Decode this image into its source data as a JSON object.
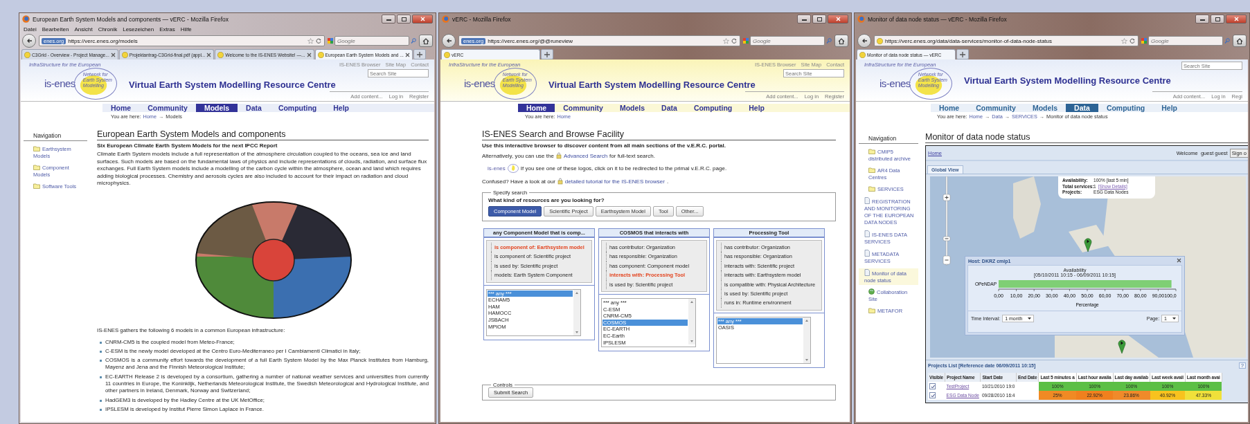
{
  "windows": [
    {
      "title": "European Earth System Models and components — vERC - Mozilla Firefox",
      "menu": [
        "Datei",
        "Bearbeiten",
        "Ansicht",
        "Chronik",
        "Lesezeichen",
        "Extras",
        "Hilfe"
      ],
      "address": {
        "badge": "enes.org",
        "url": "https://verc.enes.org/models"
      },
      "search_placeholder": "Google",
      "tabs": [
        {
          "label": "C3Grid - Overview - Project Manage...",
          "selected": false,
          "closable": true
        },
        {
          "label": "Projektantrag-C3Grid-final.pdf (appl...",
          "selected": false,
          "closable": true
        },
        {
          "label": "Welcome to the IS-ENES Website! —...",
          "selected": false,
          "closable": true
        },
        {
          "label": "European Earth System Models and ...",
          "selected": true,
          "closable": true
        }
      ],
      "site": {
        "logo": {
          "tagline": "InfraStructure for the European",
          "name": "is-enes",
          "network": "Network for Earth System Modelling"
        },
        "header_links": [
          "IS-ENES Browser",
          "Site Map",
          "Contact"
        ],
        "search_placeholder": "Search Site",
        "title": "Virtual Earth System Modelling Resource Centre",
        "user_links": [
          "Add content...",
          "Log in",
          "Register"
        ],
        "nav": [
          {
            "label": "Home",
            "selected": false
          },
          {
            "label": "Community",
            "selected": false
          },
          {
            "label": "Models",
            "selected": true
          },
          {
            "label": "Data",
            "selected": false
          },
          {
            "label": "Computing",
            "selected": false
          },
          {
            "label": "Help",
            "selected": false
          }
        ],
        "breadcrumb": {
          "label": "You are here:",
          "crumbs": [
            {
              "text": "Home",
              "link": true
            },
            {
              "before": "→",
              "text": "Models",
              "link": false
            }
          ]
        }
      },
      "page": {
        "kind": "article",
        "sidebar": {
          "heading": "Navigation",
          "items": [
            {
              "kind": "folder",
              "label": "Earthsystem Models",
              "selected": false
            },
            {
              "kind": "folder",
              "label": "Component Models",
              "selected": false
            },
            {
              "kind": "folder",
              "label": "Software Tools",
              "selected": false
            }
          ]
        },
        "heading": "European Earth System Models and components",
        "subtitle": "Six European Climate Earth System Models for the next IPCC Report",
        "paragraph": "Climate Earth System models include a full representation of the atmosphere circulation coupled to the oceans, sea ice and land surfaces. Such models are based on the fundamental laws of physics and include representations of clouds, radiation, and surface flux exchanges. Full Earth System models include a modelling of the carbon cycle within the atmosphere, ocean and land which requires adding biological processes. Chemistry and aerosols cycles are also included to account for their impact on radiation and cloud microphysics.",
        "intro": "IS-ENES gathers the following 6 models in a common European infrastructure:",
        "bullets": [
          "CNRM-CM5 is the coupled model from Meteo-France;",
          "C-ESM is the newly model developed at the Centro Euro-Mediterraneo per I Cambiamenti Climatici in Italy;",
          "COSMOS is a community effort towards the development of a full Earth System Model by the Max Planck Institutes from Hamburg, Mayenz and Jena and the Finnish Meteorological Institute;",
          "EC-EARTH Release 2 is developed by a consortium, gathering a number of national weather services and universities from currently 11 countries in Europe, the Koninklijk, Netherlands Meteorological Institute, the Swedish Meteorological and Hydrological Institute, and other partners in Ireland, Denmark, Norway and Switzerland;",
          "HadGEM3 is developed by the Hadley Centre at the UK MetOffice;",
          "IPSLESM is developed by Institut Pierre Simon Laplace in France."
        ]
      }
    },
    {
      "title": "vERC - Mozilla Firefox",
      "address": {
        "badge": "enes.org",
        "url": "https://verc.enes.org/@@runeview"
      },
      "search_placeholder": "Google",
      "tabs": [
        {
          "label": "vERC",
          "selected": true,
          "closable": false
        }
      ],
      "site": {
        "logo": {
          "tagline": "InfraStructure for the European",
          "name": "is-enes",
          "network": "Network for Earth System Modelling"
        },
        "header_links": [
          "IS-ENES Browser",
          "Site Map",
          "Contact"
        ],
        "search_placeholder": "Search Site",
        "title": "Virtual Earth System Modelling Resource Centre",
        "user_links": [
          "Add content...",
          "Log in",
          "Register"
        ],
        "nav": [
          {
            "label": "Home",
            "selected": true
          },
          {
            "label": "Community",
            "selected": false
          },
          {
            "label": "Models",
            "selected": false
          },
          {
            "label": "Data",
            "selected": false
          },
          {
            "label": "Computing",
            "selected": false
          },
          {
            "label": "Help",
            "selected": false
          }
        ],
        "breadcrumb": {
          "label": "You are here:",
          "crumbs": [
            {
              "text": "Home",
              "link": true
            }
          ]
        }
      },
      "page": {
        "kind": "browser",
        "heading": "IS-ENES Search and Browse Facility",
        "lead": "Use this interactive browser to discover content from all main sections of the v.E.R.C. portal.",
        "advanced": {
          "before": "Alternatively, you can use the",
          "link": "Advanced Search",
          "after": "for full-text search."
        },
        "logo_note": {
          "logo": "is-enes",
          "text": "If you see one of these logos, click on it to be redirected to the primal v.E.R.C. page."
        },
        "tutorial": {
          "before": "Confused? Have a look at our",
          "link": "detailed tutorial for the IS-ENES browser",
          "after": "."
        },
        "specify": {
          "legend": "Specify search",
          "question": "What kind of resources are you looking for?",
          "buttons": [
            {
              "label": "Component Model",
              "selected": true
            },
            {
              "label": "Scientific Project",
              "selected": false
            },
            {
              "label": "Earthsystem Model",
              "selected": false
            },
            {
              "label": "Tool",
              "selected": false
            },
            {
              "label": "Other...",
              "selected": false
            }
          ]
        },
        "columns": [
          {
            "header": "any Component Model that is comp...",
            "relations": [
              {
                "text": "is component of: Earthsystem model",
                "selected": true
              },
              {
                "text": "is component of: Scientific project",
                "selected": false
              },
              {
                "text": "is used by: Scientific project",
                "selected": false
              },
              {
                "text": "models: Earth System Component",
                "selected": false
              }
            ],
            "options": [
              {
                "text": "*** any ***",
                "selected": true
              },
              {
                "text": "ECHAM5",
                "selected": false
              },
              {
                "text": "HAM",
                "selected": false
              },
              {
                "text": "HAMOCC",
                "selected": false
              },
              {
                "text": "JSBACH",
                "selected": false
              },
              {
                "text": "MPIOM",
                "selected": false
              }
            ]
          },
          {
            "header": "COSMOS that interacts with",
            "relations": [
              {
                "text": "has contributor: Organization",
                "selected": false
              },
              {
                "text": "has responsible: Organization",
                "selected": false
              },
              {
                "text": "has component: Component model",
                "selected": false
              },
              {
                "text": "interacts with: Processing Tool",
                "selected": true
              },
              {
                "text": "is used by: Scientific project",
                "selected": false
              }
            ],
            "options": [
              {
                "text": "*** any ***",
                "selected": false
              },
              {
                "text": "C-ESM",
                "selected": false
              },
              {
                "text": "CNRM-CM5",
                "selected": false
              },
              {
                "text": "COSMOS",
                "selected": true
              },
              {
                "text": "EC-EARTH",
                "selected": false
              },
              {
                "text": "EC-Earth",
                "selected": false
              },
              {
                "text": "IPSLESM",
                "selected": false
              }
            ]
          },
          {
            "header": "Processing Tool",
            "relations": [
              {
                "text": "has contributor: Organization",
                "selected": false
              },
              {
                "text": "has responsible: Organization",
                "selected": false
              },
              {
                "text": "interacts with: Scientific project",
                "selected": false
              },
              {
                "text": "interacts with: Earthsystem model",
                "selected": false
              },
              {
                "text": "is compatible with: Physical Architecture",
                "selected": false
              },
              {
                "text": "is used by: Scientific project",
                "selected": false
              },
              {
                "text": "runs in: Runtime environment",
                "selected": false
              }
            ],
            "options": [
              {
                "text": "*** any ***",
                "selected": true
              },
              {
                "text": "OASIS",
                "selected": false
              }
            ]
          }
        ],
        "controls": {
          "legend": "Controls",
          "button": "Submit Search"
        }
      }
    },
    {
      "title": "Monitor of data node status — vERC - Mozilla Firefox",
      "address": {
        "url": "https://verc.enes.org/data/data-services/monitor-of-data-node-status"
      },
      "search_placeholder": "Google",
      "tabs": [
        {
          "label": "Monitor of data node status — vERC",
          "selected": true,
          "closable": false
        }
      ],
      "site": {
        "logo": {
          "tagline": "InfraStructure for the European",
          "name": "is-enes",
          "network": "Network for Earth System Modelling"
        },
        "search_placeholder": "Search Site",
        "title": "Virtual Earth System Modelling Resource Centre",
        "user_links": [
          "Add content...",
          "Log in",
          "Regi"
        ],
        "nav": [
          {
            "label": "Home",
            "selected": false
          },
          {
            "label": "Community",
            "selected": false
          },
          {
            "label": "Models",
            "selected": false
          },
          {
            "label": "Data",
            "selected": true
          },
          {
            "label": "Computing",
            "selected": false
          },
          {
            "label": "Help",
            "selected": false
          }
        ],
        "breadcrumb": {
          "label": "You are here:",
          "crumbs": [
            {
              "text": "Home",
              "link": true
            },
            {
              "before": "→",
              "text": "Data",
              "link": true
            },
            {
              "before": "→",
              "text": "SERVICES",
              "link": true
            },
            {
              "before": "→",
              "text": "Monitor of data node status",
              "link": false
            }
          ]
        }
      },
      "page": {
        "kind": "monitor",
        "sidebar": {
          "heading": "Navigation",
          "items": [
            {
              "kind": "folder",
              "label": "CMIP5 distributed archive",
              "selected": false
            },
            {
              "kind": "folder",
              "label": "AR4 Data Centres",
              "selected": false
            },
            {
              "kind": "folder",
              "label": "SERVICES",
              "selected": false,
              "children": [
                {
                  "kind": "page",
                  "label": "REGISTRATION AND MONITORING OF THE EUROPEAN DATA NODES",
                  "selected": false
                },
                {
                  "kind": "page",
                  "label": "IS-ENES DATA SERVICES",
                  "selected": false
                },
                {
                  "kind": "page",
                  "label": "METADATA SERVICES",
                  "selected": false
                },
                {
                  "kind": "page",
                  "label": "Monitor of data node status",
                  "selected": true
                }
              ]
            },
            {
              "kind": "globe",
              "label": "Collaboration Site",
              "selected": false
            },
            {
              "kind": "folder",
              "label": "METAFOR",
              "selected": false
            }
          ]
        },
        "heading": "Monitor of data node status",
        "app": {
          "zoom_slider": {
            "level": 0.3
          },
          "home_link": "Home",
          "welcome": "Welcome  guest guest",
          "sign_button": "Sign o",
          "tab": "Global View",
          "bubble": [
            {
              "label": "Availability:",
              "value": "100% [last 5 min]"
            },
            {
              "label": "Total services:",
              "value": "1",
              "link": "[Show Details]"
            },
            {
              "label": "Projects:",
              "value": "ESG Data Nodes"
            }
          ],
          "popup": {
            "title": "Host: DKRZ cmip1",
            "period": "[05/10/2011 10:15 - 06/09/2011 10:15]",
            "chart_data": {
              "type": "bar",
              "orientation": "horizontal",
              "title": "Availability",
              "xlabel": "Percentage",
              "categories": [
                "OPeNDAP"
              ],
              "values": [
                97.5
              ],
              "xlim": [
                0,
                100
              ],
              "xticks": [
                {
                  "value": 0,
                  "label": "0,00"
                },
                {
                  "value": 10,
                  "label": "10,00"
                },
                {
                  "value": 20,
                  "label": "20,00"
                },
                {
                  "value": 30,
                  "label": "30,00"
                },
                {
                  "value": 40,
                  "label": "40,00"
                },
                {
                  "value": 50,
                  "label": "50,00"
                },
                {
                  "value": 60,
                  "label": "60,00"
                },
                {
                  "value": 70,
                  "label": "70,00"
                },
                {
                  "value": 80,
                  "label": "80,00"
                },
                {
                  "value": 90,
                  "label": "90,00"
                },
                {
                  "value": 100,
                  "label": "100,0"
                }
              ]
            },
            "time_label": "Time Interval:",
            "time_value": "1 month",
            "page_label": "Page:",
            "page_value": "1"
          },
          "projects": {
            "title": "Projects List [Reference date 06/09/2011 10:15]",
            "help": "?",
            "columns": [
              "Visible",
              "Project Name",
              "Start Date",
              "End Date",
              "Last 5 minutes a",
              "Last hour availa",
              "Last day availab",
              "Last week avail",
              "Last month avai"
            ],
            "rows": [
              {
                "visible": true,
                "name": "TestProject",
                "start": "10/21/2010 19:0",
                "availability": [
                  {
                    "text": "100%",
                    "color": "#5cbf45"
                  },
                  {
                    "text": "100%",
                    "color": "#5cbf45"
                  },
                  {
                    "text": "100%",
                    "color": "#5cbf45"
                  },
                  {
                    "text": "100%",
                    "color": "#5cbf45"
                  },
                  {
                    "text": "100%",
                    "color": "#5cbf45"
                  }
                ]
              },
              {
                "visible": true,
                "name": "ESG Data Node",
                "start": "09/28/2010 16:4",
                "availability": [
                  {
                    "text": "25%",
                    "color": "#f08a24"
                  },
                  {
                    "text": "22.92%",
                    "color": "#f0801e"
                  },
                  {
                    "text": "23.86%",
                    "color": "#f08a2a"
                  },
                  {
                    "text": "40.92%",
                    "color": "#f8c21e"
                  },
                  {
                    "text": "47.33%",
                    "color": "#f0e03a"
                  }
                ]
              }
            ]
          }
        }
      }
    }
  ]
}
